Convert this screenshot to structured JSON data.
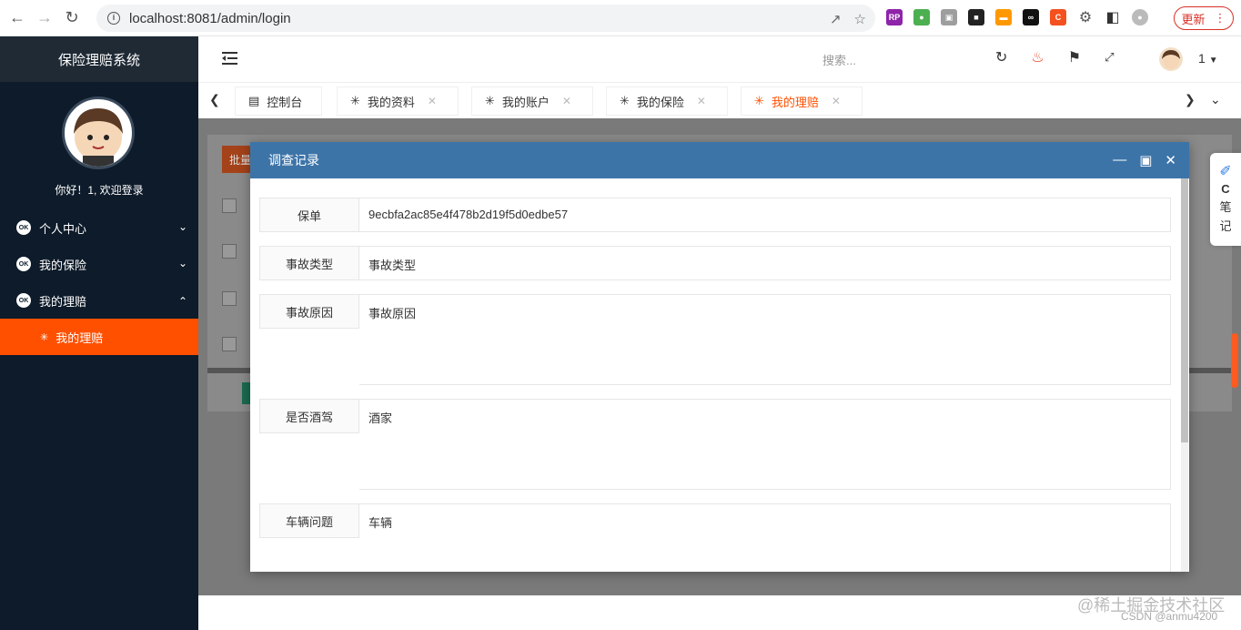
{
  "browser": {
    "url": "localhost:8081/admin/login",
    "update_label": "更新"
  },
  "sidebar": {
    "title": "保险理赔系统",
    "greeting": "你好！1, 欢迎登录",
    "items": [
      {
        "label": "个人中心",
        "icon": "ok-icon",
        "expanded": false
      },
      {
        "label": "我的保险",
        "icon": "ok-icon",
        "expanded": false
      },
      {
        "label": "我的理赔",
        "icon": "ok-icon",
        "expanded": true
      }
    ],
    "active_sub": "我的理赔",
    "active_color": "#ff5000"
  },
  "topbar": {
    "search_placeholder": "搜索...",
    "username": "1"
  },
  "tabs": [
    {
      "label": "控制台",
      "icon": "dashboard-icon",
      "closable": false
    },
    {
      "label": "我的资料",
      "icon": "palm-icon",
      "closable": true
    },
    {
      "label": "我的账户",
      "icon": "palm-icon",
      "closable": true
    },
    {
      "label": "我的保险",
      "icon": "palm-icon",
      "closable": true
    },
    {
      "label": "我的理赔",
      "icon": "palm-icon",
      "closable": true,
      "active": true
    }
  ],
  "background": {
    "batch_button": "批量"
  },
  "modal": {
    "title": "调查记录",
    "header_color": "#3d74a8",
    "fields": [
      {
        "label": "保单",
        "value": "9ecbfa2ac85e4f478b2d19f5d0edbe57"
      },
      {
        "label": "事故类型",
        "value": "事故类型"
      },
      {
        "label": "事故原因",
        "value": "事故原因"
      },
      {
        "label": "是否酒驾",
        "value": "酒家"
      },
      {
        "label": "车辆问题",
        "value": "车辆"
      }
    ]
  },
  "side_widget": {
    "line1": "C",
    "line2": "笔",
    "line3": "记"
  },
  "watermark": {
    "line1": "@稀土掘金技术社区",
    "line2": "CSDN @anmu4200"
  }
}
